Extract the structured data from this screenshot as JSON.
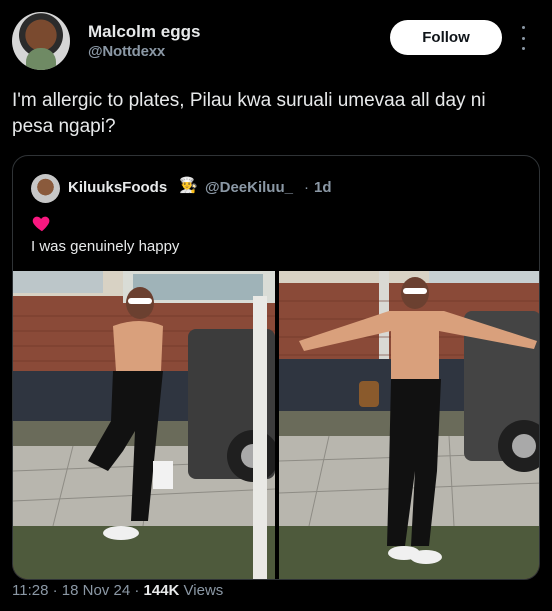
{
  "author": {
    "display_name": "Malcolm eggs",
    "handle": "@Nottdexx",
    "follow_label": "Follow"
  },
  "tweet": {
    "text": "I'm allergic to plates, Pilau kwa suruali umevaa all day ni pesa ngapi?"
  },
  "quoted": {
    "display_name": "KiluuksFoods",
    "name_emoji": "👨‍🍳",
    "handle": "@DeeKiluu_",
    "separator": "·",
    "time": "1d",
    "emoji": "heart-icon",
    "text": "I was genuinely happy",
    "media": [
      {
        "alt": "photo-left"
      },
      {
        "alt": "photo-right"
      }
    ]
  },
  "meta": {
    "time": "11:28",
    "sep1": "·",
    "date": "18 Nov 24",
    "sep2": "·",
    "views_count": "144K",
    "views_label": "Views"
  },
  "colors": {
    "background": "#000000",
    "text": "#e7e9ea",
    "secondary": "#8b98a5",
    "border": "#2f3336",
    "heart": "#f91880"
  }
}
